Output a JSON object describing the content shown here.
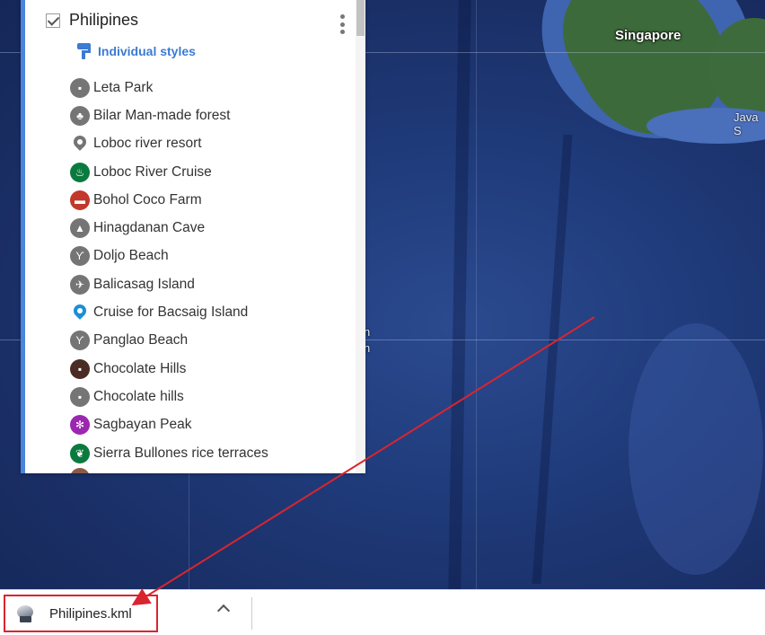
{
  "map": {
    "labels": {
      "singapore": "Singapore",
      "java_sea": "Java S",
      "partial_1": "n",
      "partial_2": "n"
    }
  },
  "layer_panel": {
    "title": "Philipines",
    "checked": true,
    "styles_link": "Individual styles",
    "places": [
      {
        "label": "Leta Park",
        "icon": "park-icon",
        "color": "#757575",
        "glyph": "▪"
      },
      {
        "label": "Bilar Man-made forest",
        "icon": "tree-icon",
        "color": "#757575",
        "glyph": "♣"
      },
      {
        "label": "Loboc river resort",
        "icon": "pin-icon",
        "color": "#757575",
        "glyph": ""
      },
      {
        "label": "Loboc River Cruise",
        "icon": "food-bowl-icon",
        "color": "#0b7a3e",
        "glyph": "♨"
      },
      {
        "label": "Bohol Coco Farm",
        "icon": "bed-icon",
        "color": "#c0392b",
        "glyph": "▬"
      },
      {
        "label": "Hinagdanan Cave",
        "icon": "cave-icon",
        "color": "#757575",
        "glyph": "▲"
      },
      {
        "label": "Doljo Beach",
        "icon": "palm-tree-icon",
        "color": "#757575",
        "glyph": "ϒ"
      },
      {
        "label": "Balicasag Island",
        "icon": "snorkel-icon",
        "color": "#757575",
        "glyph": "✈"
      },
      {
        "label": "Cruise for Bacsaig Island",
        "icon": "pin-icon",
        "color": "#1a8fd9",
        "glyph": ""
      },
      {
        "label": "Panglao Beach",
        "icon": "palm-tree-icon",
        "color": "#757575",
        "glyph": "ϒ"
      },
      {
        "label": "Chocolate Hills",
        "icon": "park-icon",
        "color": "#4a2c24",
        "glyph": "▪"
      },
      {
        "label": "Chocolate  hills",
        "icon": "park-icon",
        "color": "#757575",
        "glyph": "▪"
      },
      {
        "label": "Sagbayan Peak",
        "icon": "flower-icon",
        "color": "#9c27b0",
        "glyph": "✻"
      },
      {
        "label": "Sierra Bullones rice terraces",
        "icon": "grain-icon",
        "color": "#0b7a3e",
        "glyph": "❦"
      }
    ]
  },
  "download_bar": {
    "file_name": "Philipines.kml"
  },
  "annotation": {
    "arrow_color": "#d9252f",
    "highlight_color": "#d9252f"
  }
}
